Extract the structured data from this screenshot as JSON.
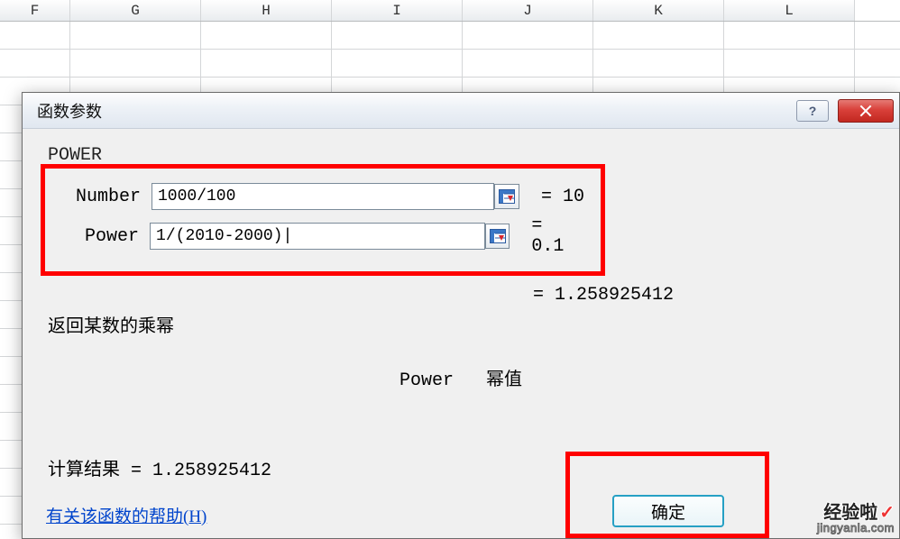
{
  "columns": [
    "F",
    "G",
    "H",
    "I",
    "J",
    "K",
    "L"
  ],
  "dialog": {
    "title": "函数参数",
    "function_name": "POWER",
    "args": [
      {
        "label": "Number",
        "value": "1000/100",
        "evaluated": "= 10"
      },
      {
        "label": "Power",
        "value": "1/(2010-2000)|",
        "evaluated": "= 0.1"
      }
    ],
    "result_preview": "= 1.258925412",
    "description": "返回某数的乘幂",
    "arg_desc_label": "Power",
    "arg_desc_text": "幂值",
    "calc_result_label": "计算结果 = ",
    "calc_result_value": "1.258925412",
    "help_link": "有关该函数的帮助(H)",
    "ok_label": "确定"
  },
  "watermark": {
    "line1": "经验啦",
    "line2": "jingyanla.com"
  }
}
